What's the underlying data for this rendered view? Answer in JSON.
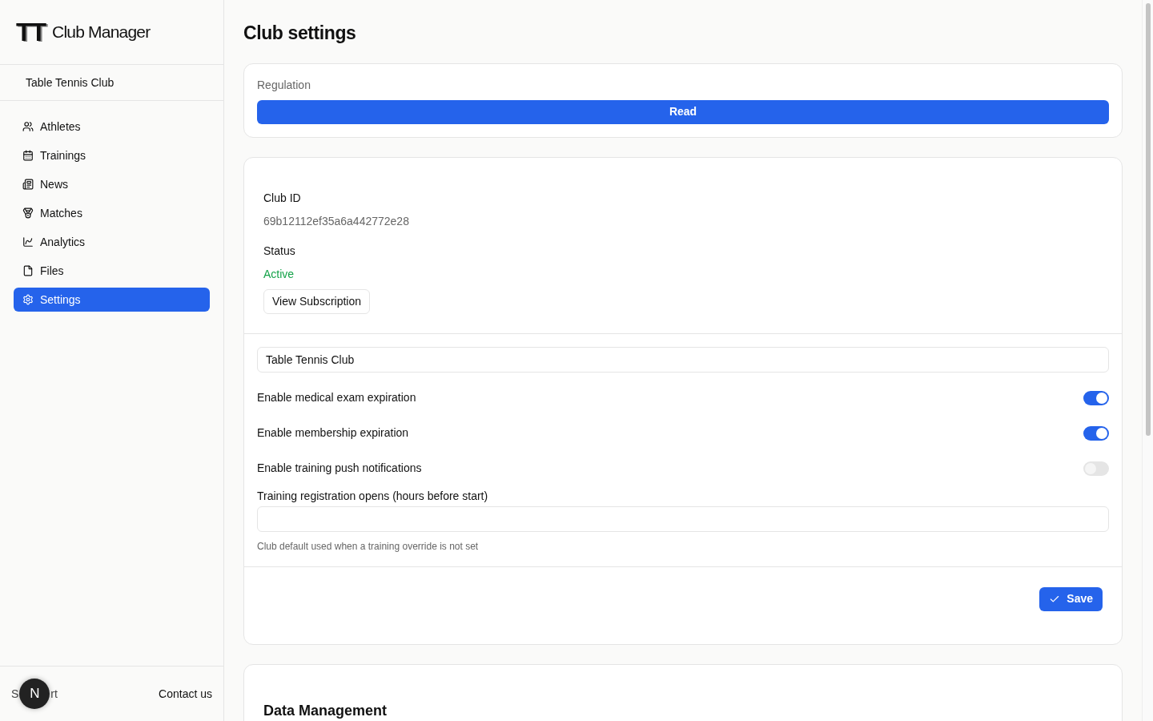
{
  "sidebar": {
    "logo_mark": "TT",
    "app_name": "Club Manager",
    "club_name": "Table Tennis Club",
    "items": [
      {
        "label": "Athletes",
        "selected": false
      },
      {
        "label": "Trainings",
        "selected": false
      },
      {
        "label": "News",
        "selected": false
      },
      {
        "label": "Matches",
        "selected": false
      },
      {
        "label": "Analytics",
        "selected": false
      },
      {
        "label": "Files",
        "selected": false
      },
      {
        "label": "Settings",
        "selected": true
      }
    ],
    "footer": {
      "support_start": "S",
      "support_end": "rt",
      "contact": "Contact us",
      "badge": "N"
    }
  },
  "page": {
    "title": "Club settings",
    "regulation": {
      "label": "Regulation",
      "button": "Read"
    },
    "info": {
      "club_id_label": "Club ID",
      "club_id": "69b12112ef35a6a442772e28",
      "status_label": "Status",
      "status": "Active",
      "subscription_button": "View Subscription"
    },
    "form": {
      "name_value": "Table Tennis Club",
      "toggles": [
        {
          "label": "Enable medical exam expiration",
          "on": true
        },
        {
          "label": "Enable membership expiration",
          "on": true
        },
        {
          "label": "Enable training push notifications",
          "on": false
        }
      ],
      "registration_label": "Training registration opens (hours before start)",
      "registration_help": "Club default used when a training override is not set",
      "save_button": "Save"
    },
    "data_management": {
      "title": "Data Management"
    }
  }
}
